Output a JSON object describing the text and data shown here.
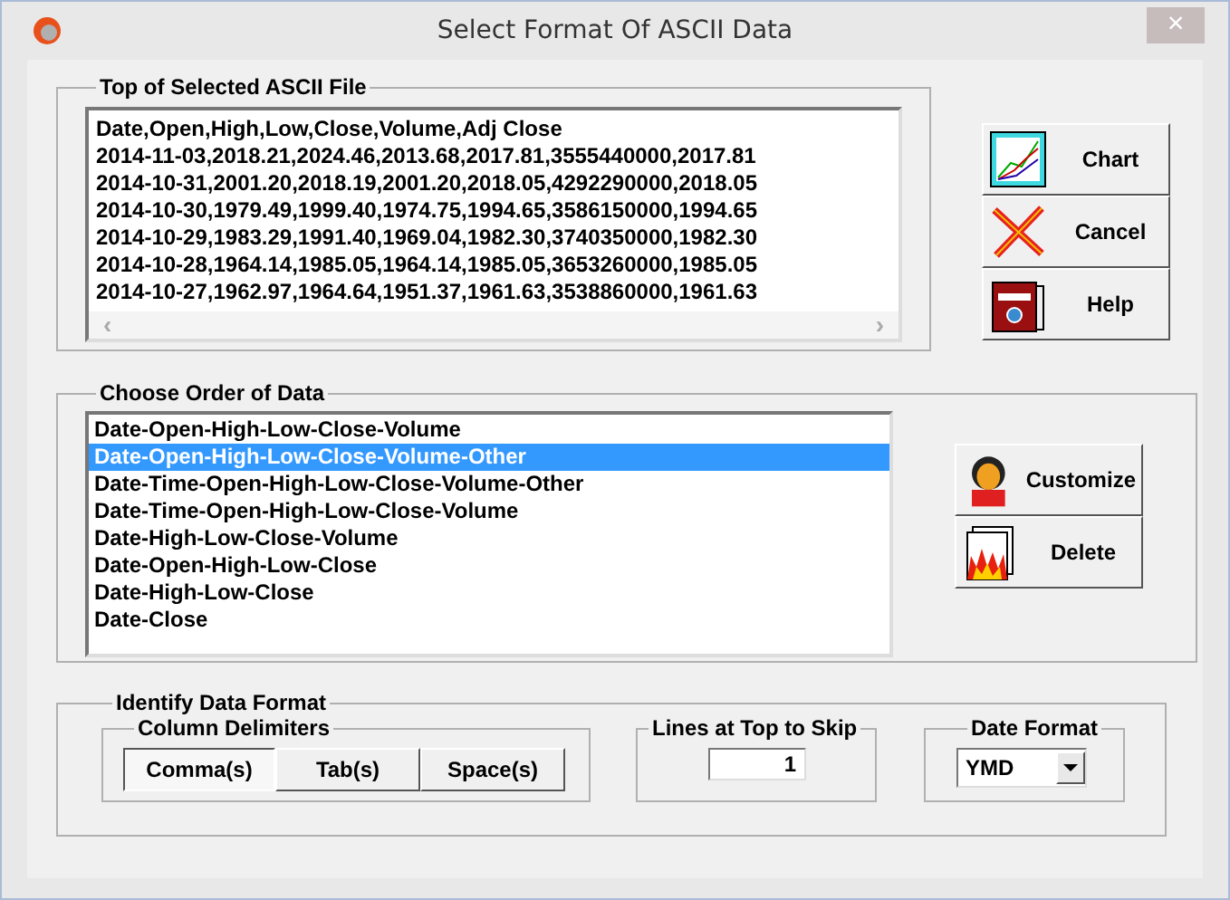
{
  "window": {
    "title": "Select Format Of ASCII Data",
    "close": "×"
  },
  "file_preview": {
    "title": "Top of Selected ASCII File",
    "lines": [
      "Date,Open,High,Low,Close,Volume,Adj Close",
      "2014-11-03,2018.21,2024.46,2013.68,2017.81,3555440000,2017.81",
      "2014-10-31,2001.20,2018.19,2001.20,2018.05,4292290000,2018.05",
      "2014-10-30,1979.49,1999.40,1974.75,1994.65,3586150000,1994.65",
      "2014-10-29,1983.29,1991.40,1969.04,1982.30,3740350000,1982.30",
      "2014-10-28,1964.14,1985.05,1964.14,1985.05,3653260000,1985.05",
      "2014-10-27,1962.97,1964.64,1951.37,1961.63,3538860000,1961.63"
    ],
    "scroll_left": "‹",
    "scroll_right": "›"
  },
  "side_buttons": [
    {
      "label": "Chart",
      "kind": "chart"
    },
    {
      "label": "Cancel",
      "kind": "cancel"
    },
    {
      "label": "Help",
      "kind": "help"
    }
  ],
  "data_order": {
    "title": "Choose Order of Data",
    "items": [
      {
        "label": "Date-Open-High-Low-Close-Volume",
        "selected": false
      },
      {
        "label": "Date-Open-High-Low-Close-Volume-Other",
        "selected": true
      },
      {
        "label": "Date-Time-Open-High-Low-Close-Volume-Other",
        "selected": false
      },
      {
        "label": "Date-Time-Open-High-Low-Close-Volume",
        "selected": false
      },
      {
        "label": "Date-High-Low-Close-Volume",
        "selected": false
      },
      {
        "label": "Date-Open-High-Low-Close",
        "selected": false
      },
      {
        "label": "Date-High-Low-Close",
        "selected": false
      },
      {
        "label": "Date-Close",
        "selected": false
      }
    ],
    "buttons": [
      {
        "label": "Customize",
        "kind": "customize"
      },
      {
        "label": "Delete",
        "kind": "delete"
      }
    ]
  },
  "data_format": {
    "title": "Identify Data Format",
    "delimiters": {
      "title": "Column Delimiters",
      "options": [
        {
          "label": "Comma(s)",
          "selected": true
        },
        {
          "label": "Tab(s)",
          "selected": false
        },
        {
          "label": "Space(s)",
          "selected": false
        }
      ]
    },
    "skip": {
      "title": "Lines at Top to Skip",
      "value": "1"
    },
    "date_format": {
      "title": "Date Format",
      "value": "YMD"
    }
  }
}
